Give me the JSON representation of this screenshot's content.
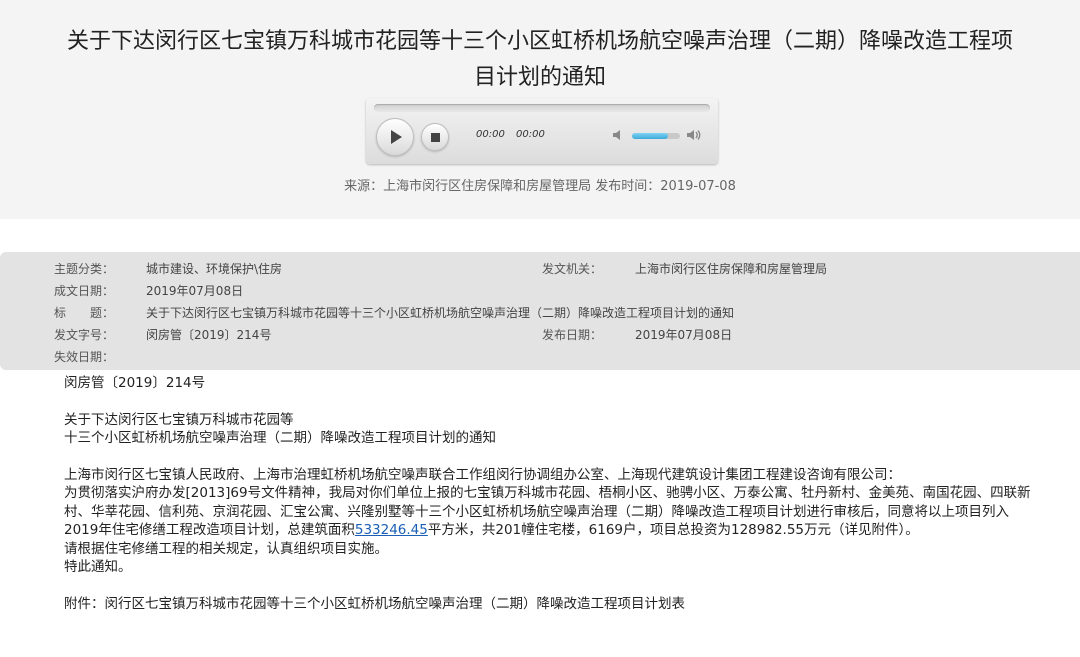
{
  "title": "关于下达闵行区七宝镇万科城市花园等十三个小区虹桥机场航空噪声治理（二期）降噪改造工程项目计划的通知",
  "player": {
    "current_time": "00:00",
    "duration": "00:00",
    "volume_level": 0.75
  },
  "source_line": "来源：上海市闵行区住房保障和房屋管理局 发布时间：2019-07-08",
  "meta": {
    "subject_label": "主题分类：",
    "subject_value": "城市建设、环境保护\\住房",
    "issuer_label": "发文机关：",
    "issuer_value": "上海市闵行区住房保障和房屋管理局",
    "date_label": "成文日期：",
    "date_value": "2019年07月08日",
    "title_label": "标　　题：",
    "title_value": "关于下达闵行区七宝镇万科城市花园等十三个小区虹桥机场航空噪声治理（二期）降噪改造工程项目计划的通知",
    "docno_label": "发文字号：",
    "docno_value": "闵房管〔2019〕214号",
    "pubdate_label": "发布日期：",
    "pubdate_value": "2019年07月08日",
    "expiry_label": "失效日期："
  },
  "body": {
    "doc_number": "闵房管〔2019〕214号",
    "heading_line1": "关于下达闵行区七宝镇万科城市花园等",
    "heading_line2": "十三个小区虹桥机场航空噪声治理（二期）降噪改造工程项目计划的通知",
    "recipients": "上海市闵行区七宝镇人民政府、上海市治理虹桥机场航空噪声联合工作组闵行协调组办公室、上海现代建筑设计集团工程建设咨询有限公司：",
    "para_before_link": "为贯彻落实沪府办发[2013]69号文件精神，我局对你们单位上报的七宝镇万科城市花园、梧桐小区、驰骋小区、万泰公寓、牡丹新村、金美苑、南国花园、四联新村、华莘花园、信利苑、京润花园、汇宝公寓、兴隆别墅等十三个小区虹桥机场航空噪声治理（二期）降噪改造工程项目计划进行审核后，同意将以上项目列入2019年住宅修缮工程改造项目计划，总建筑面积",
    "area_link": "533246.45",
    "para_after_link": "平方米，共201幢住宅楼，6169户，项目总投资为128982.55万元（详见附件）。",
    "instruction": "请根据住宅修缮工程的相关规定，认真组织项目实施。",
    "closing": "特此通知。",
    "attachment": "附件：闵行区七宝镇万科城市花园等十三个小区虹桥机场航空噪声治理（二期）降噪改造工程项目计划表"
  }
}
